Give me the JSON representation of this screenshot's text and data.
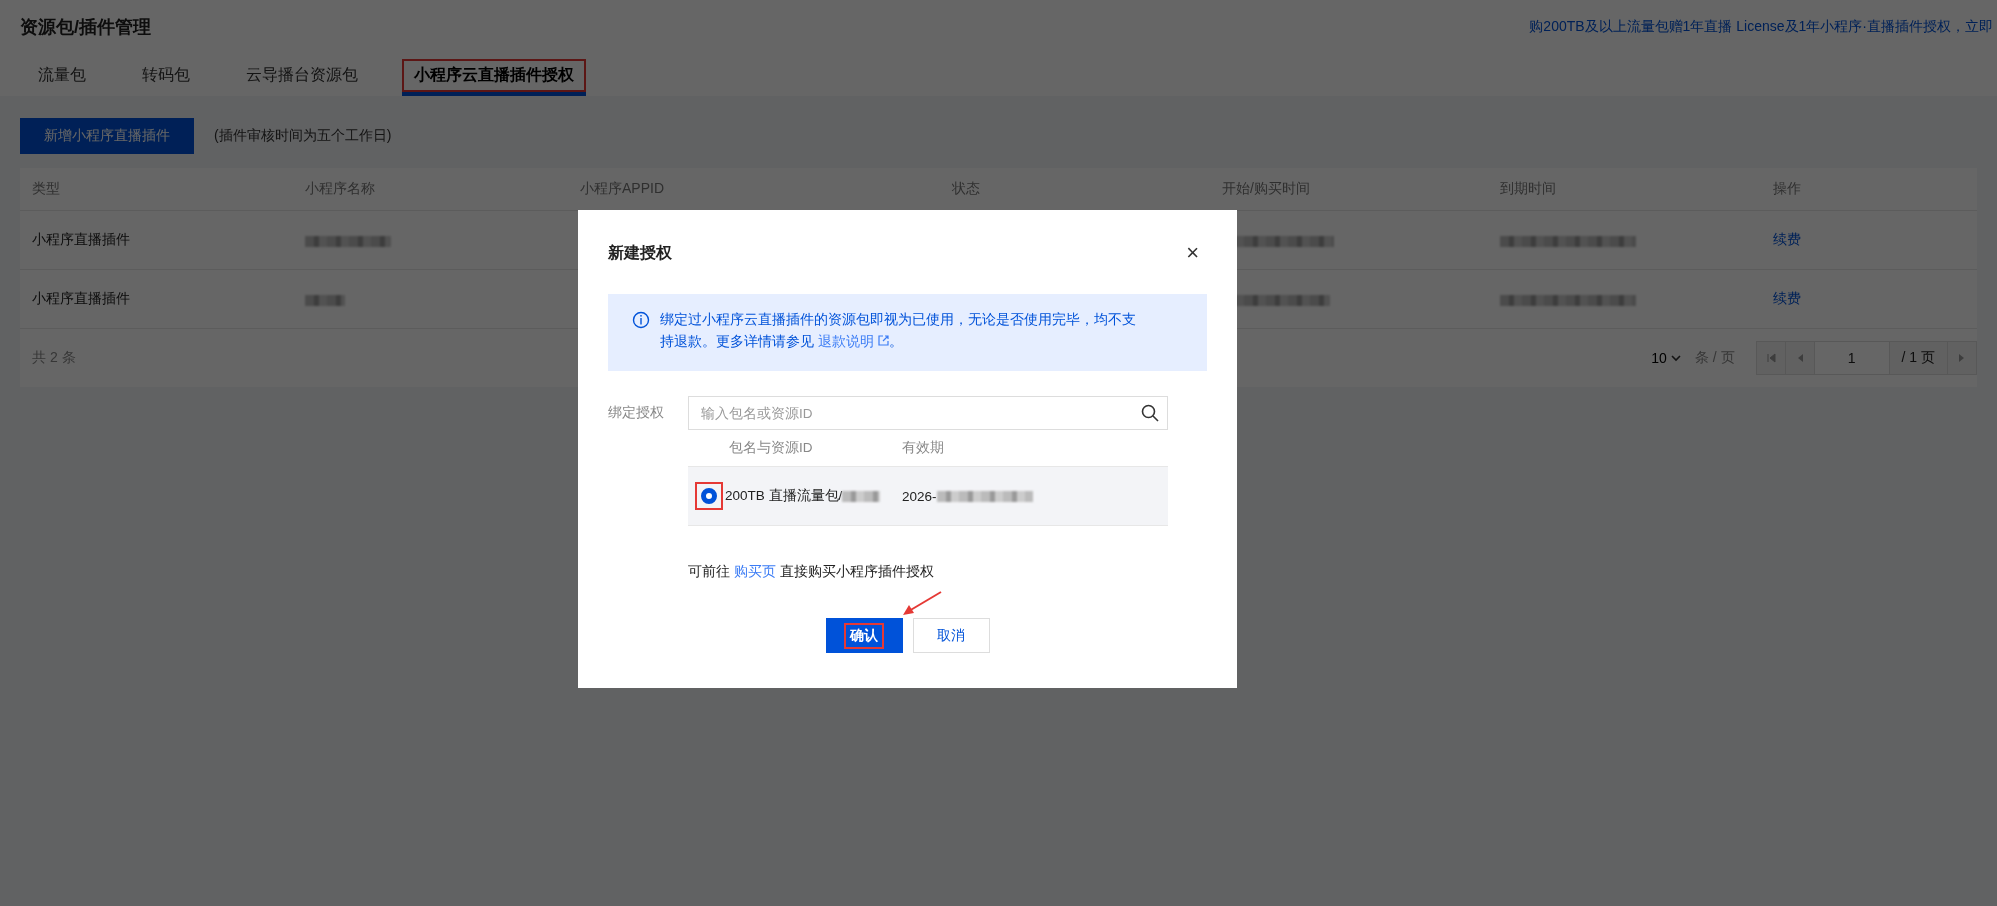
{
  "page": {
    "title": "资源包/插件管理",
    "promo": "购200TB及以上流量包赠1年直播 License及1年小程序·直播插件授权，立即"
  },
  "tabs": [
    {
      "label": "流量包",
      "selected": false,
      "highlighted": false
    },
    {
      "label": "转码包",
      "selected": false,
      "highlighted": false
    },
    {
      "label": "云导播台资源包",
      "selected": false,
      "highlighted": false
    },
    {
      "label": "小程序云直播插件授权",
      "selected": true,
      "highlighted": true
    }
  ],
  "toolbar": {
    "add_button": "新增小程序直播插件",
    "note": "(插件审核时间为五个工作日)"
  },
  "table": {
    "columns": [
      "类型",
      "小程序名称",
      "小程序APPID",
      "状态",
      "开始/购买时间",
      "到期时间",
      "操作"
    ],
    "rows": [
      {
        "type": "小程序直播插件",
        "action": "续费"
      },
      {
        "type": "小程序直播插件",
        "action": "续费"
      }
    ],
    "total": "共 2 条"
  },
  "pagination": {
    "page_size": "10",
    "unit": "条 / 页",
    "page": "1",
    "total_pages": "/ 1 页"
  },
  "dialog": {
    "title": "新建授权",
    "close": "×",
    "notice": {
      "text": "绑定过小程序云直播插件的资源包即视为已使用，无论是否使用完毕，均不支持退款。更多详情请参见 ",
      "link": "退款说明",
      "end": "。"
    },
    "field_label": "绑定授权",
    "search_placeholder": "输入包名或资源ID",
    "list_columns": [
      "包名与资源ID",
      "有效期"
    ],
    "options": [
      {
        "name": "200TB 直播流量包/",
        "validity": "2026-",
        "selected": true,
        "highlighted": true
      }
    ],
    "footer": {
      "before": "可前往 ",
      "link": "购买页",
      "after": " 直接购买小程序插件授权"
    },
    "confirm": {
      "label": "确认",
      "highlighted": true
    },
    "cancel": "取消"
  }
}
